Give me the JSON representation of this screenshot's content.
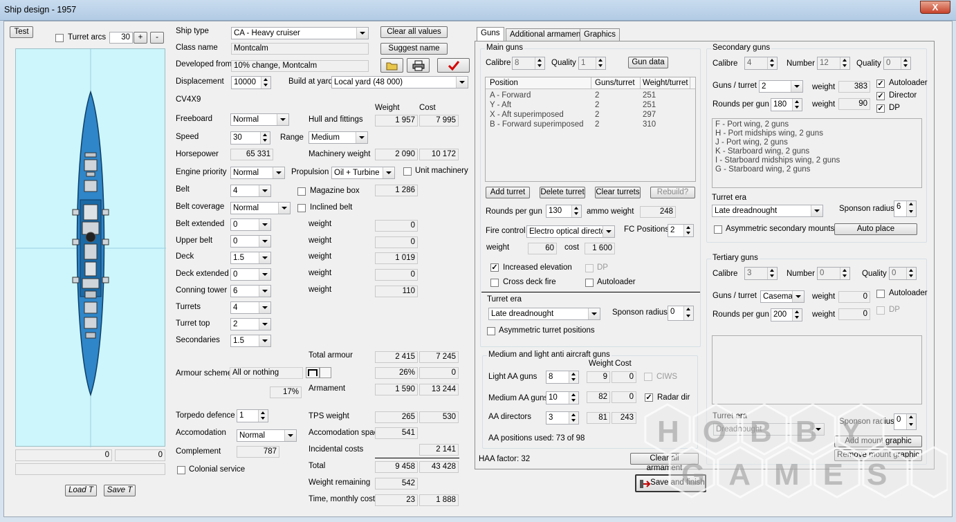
{
  "window": {
    "title": "Ship design - 1957",
    "close": "X"
  },
  "left": {
    "test": "Test",
    "turret_arcs": "Turret arcs",
    "arcs_value": "30",
    "plus": "+",
    "minus": "-",
    "val_left": "0",
    "val_right": "0",
    "load": "Load T",
    "save": "Save T"
  },
  "design": {
    "ship_type_lbl": "Ship type",
    "ship_type": "CA - Heavy cruiser",
    "class_name_lbl": "Class name",
    "class_name": "Montcalm",
    "developed_lbl": "Developed from",
    "developed": "10% change, Montcalm",
    "displacement_lbl": "Displacement",
    "displacement": "10000",
    "build_lbl": "Build at yard",
    "build": "Local yard (48 000)",
    "code": "CV4X9",
    "clear_all": "Clear all values",
    "suggest": "Suggest name",
    "weight_hdr": "Weight",
    "cost_hdr": "Cost"
  },
  "rows": [
    {
      "lbl": "Freeboard",
      "val": "Normal"
    },
    {
      "lbl": "Speed",
      "val": "30"
    },
    {
      "lbl": "Horsepower",
      "val": "65 331"
    },
    {
      "lbl": "Engine priority",
      "val": "Normal"
    },
    {
      "lbl": "Belt",
      "val": "4"
    },
    {
      "lbl": "Belt coverage",
      "val": "Normal"
    },
    {
      "lbl": "Belt extended",
      "val": "0"
    },
    {
      "lbl": "Upper belt",
      "val": "0"
    },
    {
      "lbl": "Deck",
      "val": "1.5"
    },
    {
      "lbl": "Deck extended",
      "val": "0"
    },
    {
      "lbl": "Conning tower",
      "val": "6"
    },
    {
      "lbl": "Turrets",
      "val": "4"
    },
    {
      "lbl": "Turret top",
      "val": "2"
    },
    {
      "lbl": "Secondaries",
      "val": "1.5"
    }
  ],
  "mid": {
    "range_lbl": "Range",
    "range": "Medium",
    "propulsion_lbl": "Propulsion",
    "propulsion": "Oil + Turbine",
    "unit_machinery": "Unit machinery",
    "magazine_box": "Magazine box",
    "inclined_belt": "Inclined belt",
    "hull_lbl": "Hull and fittings",
    "hull_w": "1 957",
    "hull_c": "7 995",
    "mach_lbl": "Machinery weight",
    "mach_w": "2 090",
    "mach_c": "10 172",
    "mag_w": "1 286",
    "weight_lbl": "weight",
    "w1": "0",
    "w2": "0",
    "w3": "1 019",
    "w4": "0",
    "w5": "110",
    "total_armour_lbl": "Total armour",
    "ta_w": "2 415",
    "ta_c": "7 245",
    "armour_scheme_lbl": "Armour scheme",
    "armour_scheme": "All or nothing",
    "pct1": "26%",
    "pct1b": "0",
    "pct2": "17%",
    "armament_lbl": "Armament",
    "arm_w": "1 590",
    "arm_c": "13 244",
    "torpedo_lbl": "Torpedo defence",
    "torpedo": "1",
    "tps_lbl": "TPS weight",
    "tps_w": "265",
    "tps_c": "530",
    "accom_lbl": "Accomodation",
    "accom": "Normal",
    "accom_space_lbl": "Accomodation space",
    "accom_space": "541",
    "complement_lbl": "Complement",
    "complement": "787",
    "incidental_lbl": "Incidental costs",
    "incidental": "2 141",
    "colonial": "Colonial service",
    "total_lbl": "Total",
    "total_w": "9 458",
    "total_c": "43 428",
    "remaining_lbl": "Weight remaining",
    "remaining": "542",
    "time_lbl": "Time, monthly cost",
    "time": "23",
    "monthly": "1 888"
  },
  "tabs": [
    "Guns",
    "Additional armament",
    "Graphics"
  ],
  "main_guns": {
    "title": "Main guns",
    "calibre_lbl": "Calibre",
    "calibre": "8",
    "quality_lbl": "Quality",
    "quality": "1",
    "gun_data": "Gun data",
    "headers": [
      "Position",
      "Guns/turret",
      "Weight/turret"
    ],
    "rows": [
      [
        "A - Forward",
        "2",
        "251"
      ],
      [
        "Y - Aft",
        "2",
        "251"
      ],
      [
        "X - Aft superimposed",
        "2",
        "297"
      ],
      [
        "B - Forward superimposed",
        "2",
        "310"
      ]
    ],
    "add": "Add turret",
    "delete": "Delete turret",
    "clear": "Clear turrets",
    "rebuild": "Rebuild?",
    "rounds_lbl": "Rounds per gun",
    "rounds": "130",
    "ammo_lbl": "ammo weight",
    "ammo": "248",
    "fire_lbl": "Fire control",
    "fire": "Electro optical director",
    "fc_lbl": "FC Positions",
    "fc": "2",
    "weight_lbl": "weight",
    "weight": "60",
    "cost_lbl": "cost",
    "cost": "1 600",
    "increased": "Increased elevation",
    "dp": "DP",
    "cross": "Cross deck fire",
    "autoloader": "Autoloader",
    "era_lbl": "Turret era",
    "era": "Late dreadnought",
    "sponson_lbl": "Sponson radius",
    "sponson": "0",
    "asym": "Asymmetric turret positions"
  },
  "aa": {
    "title": "Medium and light anti aircraft guns",
    "weight_hdr": "Weight",
    "cost_hdr": "Cost",
    "light_lbl": "Light AA guns",
    "light": "8",
    "light_w": "9",
    "light_c": "0",
    "ciws": "CIWS",
    "medium_lbl": "Medium AA guns",
    "medium": "10",
    "medium_w": "82",
    "medium_c": "0",
    "radar": "Radar dir",
    "dir_lbl": "AA directors",
    "dir": "3",
    "dir_w": "81",
    "dir_c": "243",
    "used": "AA positions used: 73 of 98"
  },
  "haa": "HAA factor: 32",
  "clear_arm": "Clear all armament",
  "save_finish": "Save and finish",
  "secondary": {
    "title": "Secondary guns",
    "calibre_lbl": "Calibre",
    "calibre": "4",
    "number_lbl": "Number",
    "number": "12",
    "quality_lbl": "Quality",
    "quality": "0",
    "gpt_lbl": "Guns / turret",
    "gpt": "2",
    "weight_lbl": "weight",
    "weight": "383",
    "autoloader": "Autoloader",
    "rounds_lbl": "Rounds per gun",
    "rounds": "180",
    "weight2": "90",
    "director": "Director",
    "dp": "DP",
    "list": [
      "F - Port wing, 2 guns",
      "H - Port midships wing, 2 guns",
      "J - Port wing, 2 guns",
      "K - Starboard wing, 2 guns",
      "I - Starboard midships wing, 2 guns",
      "G - Starboard wing, 2 guns"
    ],
    "era_lbl": "Turret era",
    "era": "Late dreadnought",
    "sponson_lbl": "Sponson radius",
    "sponson": "6",
    "asym": "Asymmetric secondary mounts",
    "auto": "Auto place"
  },
  "tertiary": {
    "title": "Tertiary guns",
    "calibre_lbl": "Calibre",
    "calibre": "3",
    "number_lbl": "Number",
    "number": "0",
    "quality_lbl": "Quality",
    "quality": "0",
    "gpt_lbl": "Guns / turret",
    "gpt": "Casemate",
    "weight_lbl": "weight",
    "weight": "0",
    "autoloader": "Autoloader",
    "rounds_lbl": "Rounds per gun",
    "rounds": "200",
    "weight2": "0",
    "dp": "DP",
    "era_lbl": "Turret era",
    "era": "Dreadnought",
    "sponson_lbl": "Sponson radius",
    "sponson": "0",
    "add_mount": "Add mount graphic",
    "remove_mount": "Remove mount graphic"
  },
  "watermark": {
    "line1": "HOBBY",
    "line2": "GAMES"
  }
}
